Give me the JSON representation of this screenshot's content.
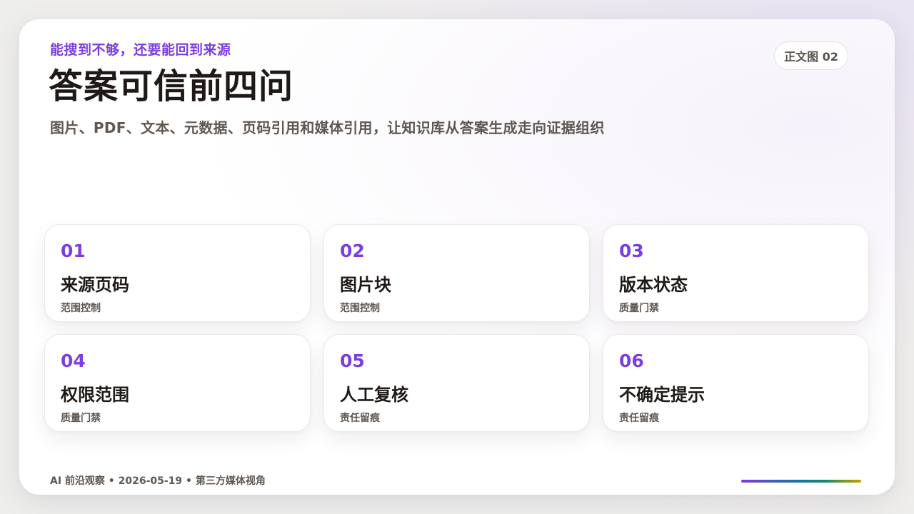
{
  "header": {
    "kicker": "能搜到不够，还要能回到来源",
    "title": "答案可信前四问",
    "subtitle": "图片、PDF、文本、元数据、页码引用和媒体引用，让知识库从答案生成走向证据组织",
    "badge": "正文图 02"
  },
  "cards": [
    {
      "num": "01",
      "title": "来源页码",
      "tag": "范围控制"
    },
    {
      "num": "02",
      "title": "图片块",
      "tag": "范围控制"
    },
    {
      "num": "03",
      "title": "版本状态",
      "tag": "质量门禁"
    },
    {
      "num": "04",
      "title": "权限范围",
      "tag": "质量门禁"
    },
    {
      "num": "05",
      "title": "人工复核",
      "tag": "责任留痕"
    },
    {
      "num": "06",
      "title": "不确定提示",
      "tag": "责任留痕"
    }
  ],
  "footer": {
    "text": "AI 前沿观察 • 2026-05-19 • 第三方媒体视角"
  },
  "colors": {
    "accent": "#7b3fe0",
    "title": "#1f1a17",
    "muted": "#5f5750",
    "gradient": [
      "#7b3fe0",
      "#1f6fa8",
      "#148a6e",
      "#c9a000"
    ]
  }
}
